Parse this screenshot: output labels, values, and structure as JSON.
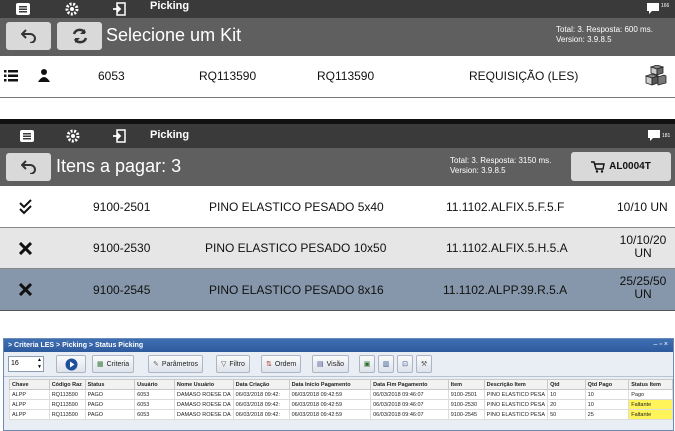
{
  "screen1": {
    "topbar_title": "Picking",
    "badge": "166",
    "header_title": "Selecione um Kit",
    "info_line1": "Total: 3. Resposta: 600 ms.",
    "info_line2": "Version: 3.9.8.5",
    "row": {
      "col1": "6053",
      "col2": "RQ113590",
      "col3": "RQ113590",
      "col4": "REQUISIÇÃO (LES)"
    }
  },
  "screen2": {
    "topbar_title": "Picking",
    "badge": "181",
    "header_title": "Itens a pagar: 3",
    "info_line1": "Total: 3. Resposta: 3150 ms.",
    "info_line2": "Version: 3.9.8.5",
    "cart_button_label": "AL0004T",
    "items": [
      {
        "code": "9100-2501",
        "desc": "PINO ELASTICO PESADO 5x40",
        "item": "11.1102.ALFIX.5.F.5.F",
        "qty": "10/10 UN",
        "status": "done"
      },
      {
        "code": "9100-2530",
        "desc": "PINO ELASTICO PESADO 10x50",
        "item": "11.1102.ALFIX.5.H.5.A",
        "qty_line1": "10/10/20",
        "qty_line2": "UN",
        "status": "missing"
      },
      {
        "code": "9100-2545",
        "desc": "PINO ELASTICO PESADO 8x16",
        "item": "11.1102.ALPP.39.R.5.A",
        "qty_line1": "25/25/50",
        "qty_line2": "UN",
        "status": "missing"
      }
    ]
  },
  "screen3": {
    "window_title": "> Criteria LES > Picking > Status Picking",
    "page_size_value": "16",
    "toolbar": {
      "criteria": "Criteria",
      "parametros": "Parâmetros",
      "filtro": "Filtro",
      "ordem": "Ordem",
      "visao": "Visão"
    },
    "table": {
      "headers": [
        "Chave",
        "Código Raz",
        "Status",
        "Usuário",
        "Nome Usuário",
        "Data Criação",
        "Data Início Pagamento",
        "Data Fim Pagamento",
        "Item",
        "Descrição Item",
        "Qtd",
        "Qtd Pago",
        "Status Item"
      ],
      "rows": [
        [
          "ALPP",
          "RQ113590",
          "PAGO",
          "6053",
          "DAMASO ROESE DA",
          "06/03/2018 09:42:",
          "06/03/2018 09:42:59",
          "06/03/2018 09:46:07",
          "9100-2501",
          "PINO ELASTICO PESA",
          "10",
          "10",
          "Pago"
        ],
        [
          "ALPP",
          "RQ113590",
          "PAGO",
          "6053",
          "DAMASO ROESE DA",
          "06/03/2018 09:42:",
          "06/03/2018 09:42:59",
          "06/03/2018 09:46:07",
          "9100-2530",
          "PINO ELASTICO PESA",
          "20",
          "10",
          "Faltante"
        ],
        [
          "ALPP",
          "RQ113590",
          "PAGO",
          "6053",
          "DAMASO ROESE DA",
          "06/03/2018 09:42:",
          "06/03/2018 09:42:59",
          "06/03/2018 09:46:07",
          "9100-2545",
          "PINO ELASTICO PESA",
          "50",
          "25",
          "Faltante"
        ]
      ]
    }
  }
}
